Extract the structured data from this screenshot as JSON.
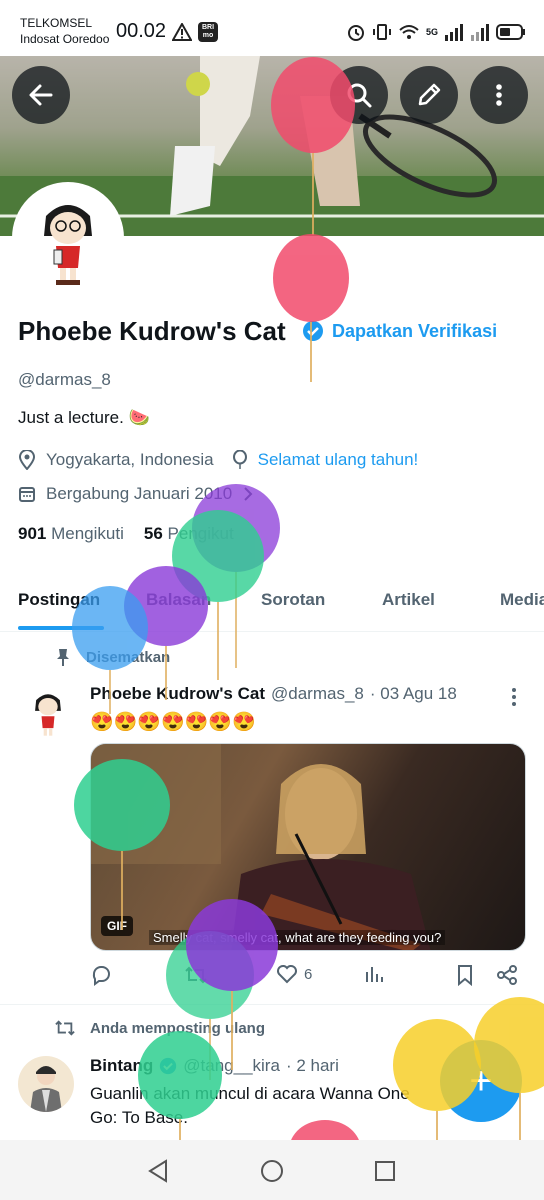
{
  "status_bar": {
    "carrier_1": "TELKOMSEL",
    "carrier_2": "Indosat Ooredoo",
    "time": "00.02",
    "app_badge": "BRI mo",
    "network": "5G"
  },
  "header": {
    "back_icon": "arrow-left-icon",
    "search_icon": "search-icon",
    "edit_icon": "pencil-icon",
    "more_icon": "more-vertical-icon"
  },
  "profile": {
    "name": "Phoebe Kudrow's Cat",
    "verify_label": "Dapatkan Verifikasi",
    "handle": "@darmas_8",
    "bio": "Just a lecture. 🍉",
    "location": "Yogyakarta, Indonesia",
    "birthday": "Selamat ulang tahun!",
    "joined": "Bergabung Januari 2010",
    "following_count": "901",
    "following_label": "Mengikuti",
    "followers_count": "56",
    "followers_label": "Pengikut"
  },
  "tabs": [
    {
      "label": "Postingan",
      "active": true
    },
    {
      "label": "Balasan",
      "active": false
    },
    {
      "label": "Sorotan",
      "active": false
    },
    {
      "label": "Artikel",
      "active": false
    },
    {
      "label": "Media",
      "active": false
    }
  ],
  "pinned_post": {
    "pinned_label": "Disematkan",
    "name": "Phoebe Kudrow's Cat",
    "handle": "@darmas_8",
    "date": "· 03 Agu 18",
    "text": "😍😍😍😍😍😍😍",
    "gif_badge": "GIF",
    "caption": "Smelly cat, smelly cat, what are they feeding you?",
    "likes": "6"
  },
  "repost": {
    "repost_label": "Anda memposting ulang",
    "name": "Bintang",
    "handle": "@tang__kira",
    "date": "· 2 hari",
    "text": "Guanlin akan muncul di acara Wanna One Go: To Base."
  },
  "fab": {
    "label": "+"
  },
  "colors": {
    "accent": "#1d9bf0",
    "text": "#0f1419",
    "muted": "#536471"
  }
}
